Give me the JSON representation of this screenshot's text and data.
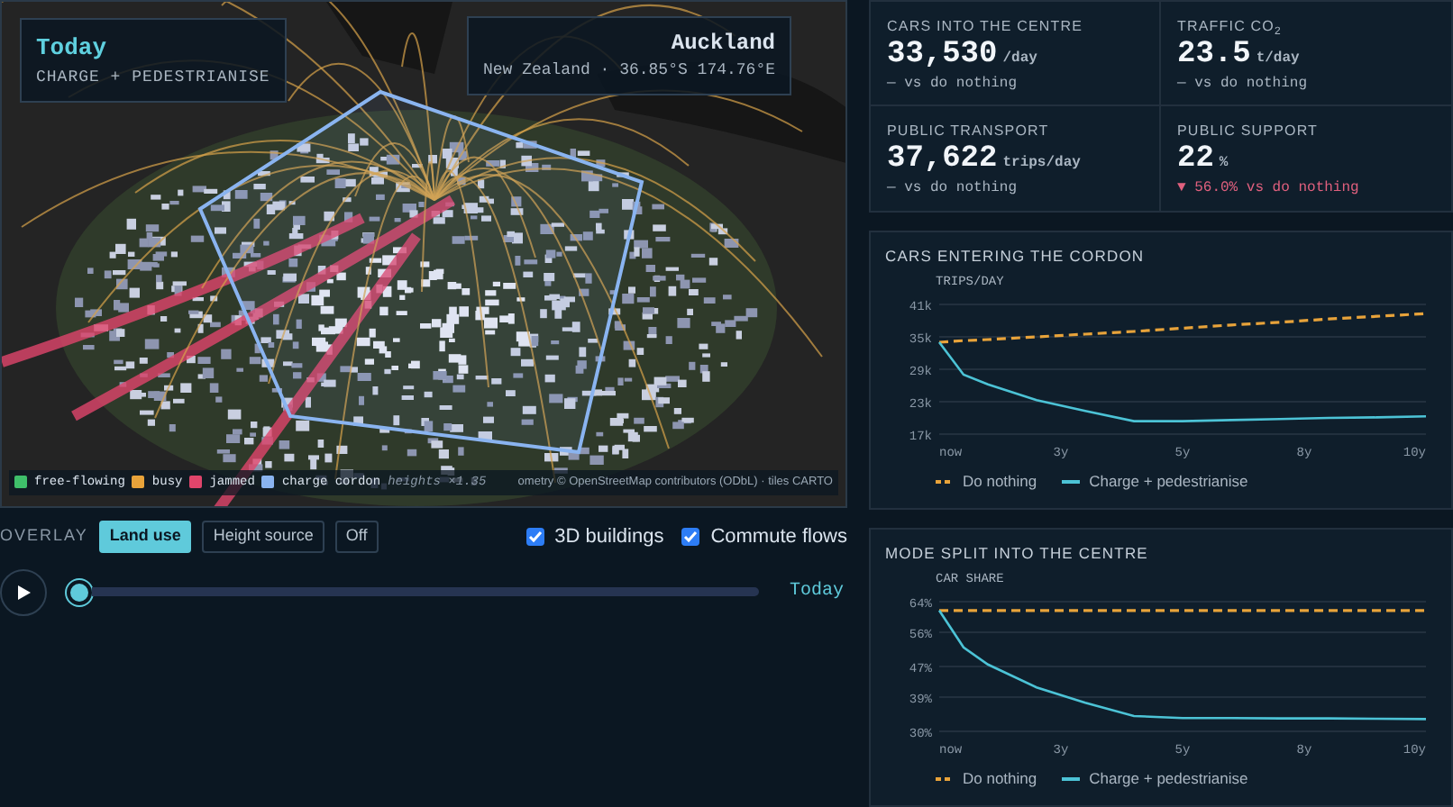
{
  "map": {
    "title": "Today",
    "subtitle": "CHARGE + PEDESTRIANISE",
    "place": "Auckland",
    "place_detail": "New Zealand · 36.85°S 174.76°E",
    "legend": [
      {
        "label": "free-flowing",
        "color": "#3fbf6a"
      },
      {
        "label": "busy",
        "color": "#e8a33a"
      },
      {
        "label": "jammed",
        "color": "#e0456b"
      },
      {
        "label": "charge cordon",
        "color": "#8ab4f0"
      }
    ],
    "height_note": "heights ×1.35",
    "attribution": "ometry © OpenStreetMap contributors (ODbL) · tiles CARTO"
  },
  "overlay": {
    "label": "OVERLAY",
    "options": [
      {
        "label": "Land use",
        "selected": true
      },
      {
        "label": "Height source",
        "selected": false
      },
      {
        "label": "Off",
        "selected": false
      }
    ]
  },
  "toggles": [
    {
      "label": "3D buildings",
      "checked": true
    },
    {
      "label": "Commute flows",
      "checked": true
    }
  ],
  "timeline": {
    "level": 0,
    "label": "Today"
  },
  "kpis": [
    {
      "label": "CARS INTO THE CENTRE",
      "value": "33,530",
      "unit": "/day",
      "delta": "— vs do nothing",
      "negative": false
    },
    {
      "label": "TRAFFIC CO$_{2}$",
      "value": "23.5",
      "unit": "t/day",
      "delta": "— vs do nothing",
      "negative": false
    },
    {
      "label": "PUBLIC TRANSPORT",
      "value": "37,622",
      "unit": "trips/day",
      "delta": "— vs do nothing",
      "negative": false
    },
    {
      "label": "PUBLIC SUPPORT",
      "value": "22",
      "unit": "%",
      "delta": "▼ 56.0% vs do nothing",
      "negative": true
    }
  ],
  "charts": [
    {
      "chart_data": {
        "type": "line",
        "title": "CARS ENTERING THE CORDON",
        "ylabel": "TRIPS/DAY",
        "x": [
          0,
          0.5,
          1,
          2,
          3,
          4,
          5,
          6,
          7,
          8,
          9,
          10
        ],
        "xlim": [
          0,
          10
        ],
        "ylim": [
          17000,
          41000
        ],
        "grid": true,
        "yticks": [
          {
            "value": 17000,
            "label": "17k"
          },
          {
            "value": 23000,
            "label": "23k"
          },
          {
            "value": 29000,
            "label": "29k"
          },
          {
            "value": 35000,
            "label": "35k"
          },
          {
            "value": 41000,
            "label": "41k"
          }
        ],
        "xticks": [
          {
            "value": 0,
            "label": "now"
          },
          {
            "value": 2.5,
            "label": "3y"
          },
          {
            "value": 5,
            "label": "5y"
          },
          {
            "value": 7.5,
            "label": "8y"
          },
          {
            "value": 10,
            "label": "10y"
          }
        ],
        "series": [
          {
            "name": "Do nothing",
            "color": "#e8a33a",
            "line_style": "dashed",
            "values": [
              34000,
              34300,
              34500,
              35000,
              35500,
              36000,
              36600,
              37200,
              37700,
              38300,
              38800,
              39300
            ]
          },
          {
            "name": "Charge + pedestrianise",
            "color": "#4cc3d6",
            "line_style": "solid",
            "values": [
              34000,
              28000,
              26200,
              23300,
              21300,
              19400,
              19400,
              19600,
              19800,
              20000,
              20100,
              20300
            ]
          }
        ]
      }
    },
    {
      "chart_data": {
        "type": "line",
        "title": "MODE SPLIT INTO THE CENTRE",
        "ylabel": "CAR SHARE",
        "x": [
          0,
          0.5,
          1,
          2,
          3,
          4,
          5,
          6,
          7,
          8,
          9,
          10
        ],
        "xlim": [
          0,
          10
        ],
        "ylim": [
          30,
          64
        ],
        "grid": true,
        "yticks": [
          {
            "value": 30,
            "label": "30%"
          },
          {
            "value": 39,
            "label": "39%"
          },
          {
            "value": 47,
            "label": "47%"
          },
          {
            "value": 56,
            "label": "56%"
          },
          {
            "value": 64,
            "label": "64%"
          }
        ],
        "xticks": [
          {
            "value": 0,
            "label": "now"
          },
          {
            "value": 2.5,
            "label": "3y"
          },
          {
            "value": 5,
            "label": "5y"
          },
          {
            "value": 7.5,
            "label": "8y"
          },
          {
            "value": 10,
            "label": "10y"
          }
        ],
        "series": [
          {
            "name": "Do nothing",
            "color": "#e8a33a",
            "line_style": "dashed",
            "values": [
              61.7,
              61.7,
              61.7,
              61.7,
              61.7,
              61.7,
              61.7,
              61.7,
              61.7,
              61.7,
              61.7,
              61.7
            ]
          },
          {
            "name": "Charge + pedestrianise",
            "color": "#4cc3d6",
            "line_style": "solid",
            "values": [
              61.7,
              52,
              47.5,
              41.5,
              37.5,
              34,
              33.5,
              33.5,
              33.4,
              33.4,
              33.3,
              33.2
            ]
          }
        ]
      }
    }
  ]
}
